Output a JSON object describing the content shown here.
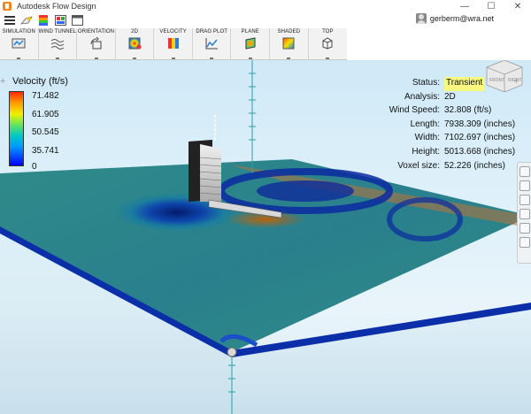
{
  "window": {
    "title": "Autodesk Flow Design",
    "minimize_glyph": "—",
    "maximize_glyph": "☐",
    "close_glyph": "✕"
  },
  "quickbar": {
    "icons": [
      "menu-icon",
      "open-icon",
      "palette-icon",
      "images-icon",
      "window-icon"
    ]
  },
  "user": {
    "name": "gerberm@wra.net"
  },
  "ribbon": {
    "items": [
      {
        "label": "SIMULATION",
        "icon": "simulation-icon"
      },
      {
        "label": "WIND TUNNEL",
        "icon": "wind-tunnel-icon"
      },
      {
        "label": "ORIENTATION",
        "icon": "orientation-icon"
      },
      {
        "label": "2D",
        "icon": "2d-icon"
      },
      {
        "label": "VELOCITY",
        "icon": "velocity-icon"
      },
      {
        "label": "DRAG PLOT",
        "icon": "drag-plot-icon"
      },
      {
        "label": "PLANE",
        "icon": "plane-icon"
      },
      {
        "label": "SHADED",
        "icon": "shaded-icon"
      }
    ],
    "last": {
      "label": "TOP",
      "icon": "top-view-icon"
    }
  },
  "legend": {
    "title": "Velocity (ft/s)",
    "ticks": [
      "71.482",
      "61.905",
      "50.545",
      "35.741",
      "0"
    ],
    "plus": "+"
  },
  "info": {
    "status_label": "Status:",
    "status_value": "Transient",
    "analysis_label": "Analysis:",
    "analysis_value": "2D",
    "wind_speed_label": "Wind Speed:",
    "wind_speed_value": "32.808 (ft/s)",
    "length_label": "Length:",
    "length_value": "7938.309 (inches)",
    "width_label": "Width:",
    "width_value": "7102.697 (inches)",
    "height_label": "Height:",
    "height_value": "5013.668 (inches)",
    "voxel_label": "Voxel size:",
    "voxel_value": "52.226 (inches)"
  },
  "viewcube": {
    "front": "FRONT",
    "right": "RIGHT"
  },
  "colors": {
    "accent": "#f08a1c",
    "status_highlight": "#f8f880"
  }
}
